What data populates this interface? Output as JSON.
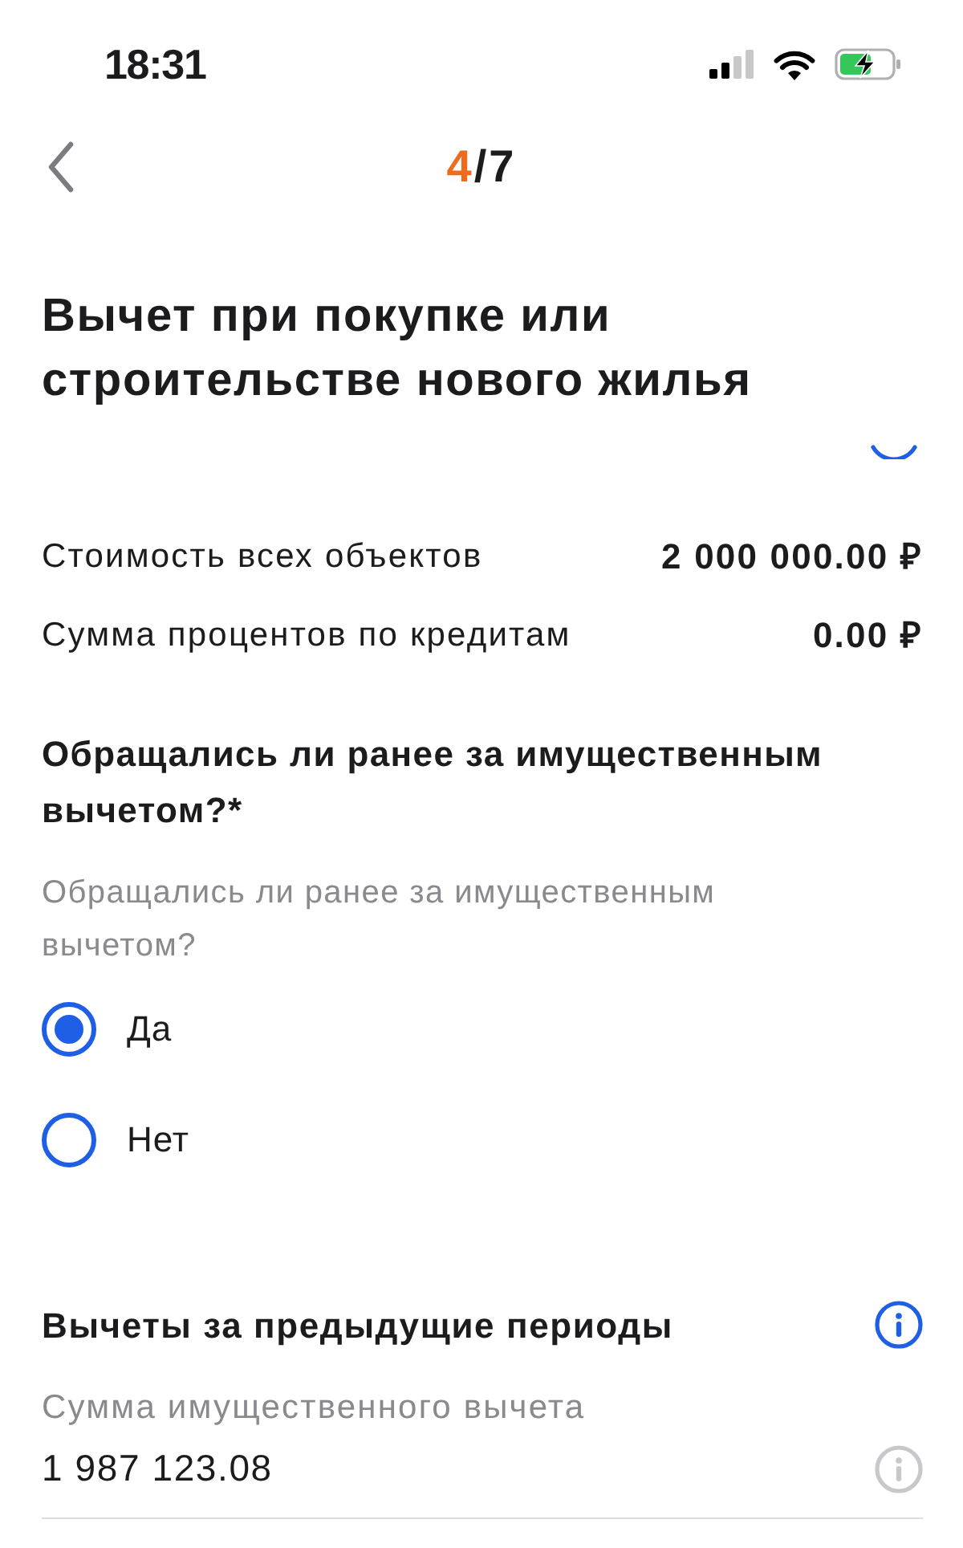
{
  "status_bar": {
    "time": "18:31"
  },
  "nav": {
    "step": "4",
    "of_total": "/7"
  },
  "title": "Вычет при покупке или строительстве нового жилья",
  "summary_rows": [
    {
      "label": "Стоимость всех объектов",
      "value": "2 000 000.00 ₽"
    },
    {
      "label": "Сумма процентов по кредитам",
      "value": "0.00 ₽"
    }
  ],
  "question": {
    "title": "Обращались ли ранее за имущественным вычетом?*",
    "hint": "Обращались ли ранее за имущественным вычетом?",
    "options": [
      {
        "label": "Да",
        "selected": true
      },
      {
        "label": "Нет",
        "selected": false
      }
    ]
  },
  "previous_deductions": {
    "title": "Вычеты за предыдущие периоды",
    "field": {
      "label": "Сумма имущественного вычета",
      "value": "1 987 123.08"
    }
  }
}
